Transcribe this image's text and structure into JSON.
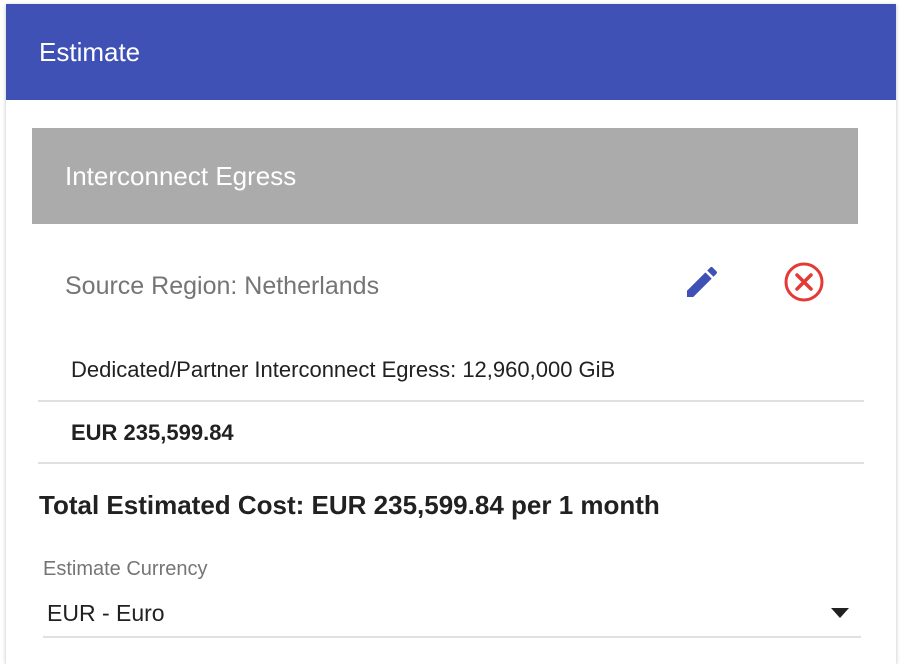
{
  "header": {
    "title": "Estimate"
  },
  "item": {
    "title": "Interconnect Egress",
    "region_label": "Source Region: Netherlands",
    "usage_label": "Dedicated/Partner Interconnect Egress: 12,960,000 GiB",
    "cost": "EUR 235,599.84",
    "edit_icon": "pencil-icon",
    "remove_icon": "circle-x-icon"
  },
  "summary": {
    "total_text": "Total Estimated Cost: EUR 235,599.84 per 1 month"
  },
  "currency": {
    "label": "Estimate Currency",
    "selected": "EUR - Euro"
  },
  "colors": {
    "header_bg": "#3f51b5",
    "item_title_bg": "#ababab",
    "edit_icon": "#3f51b5",
    "remove_icon": "#e53935"
  }
}
